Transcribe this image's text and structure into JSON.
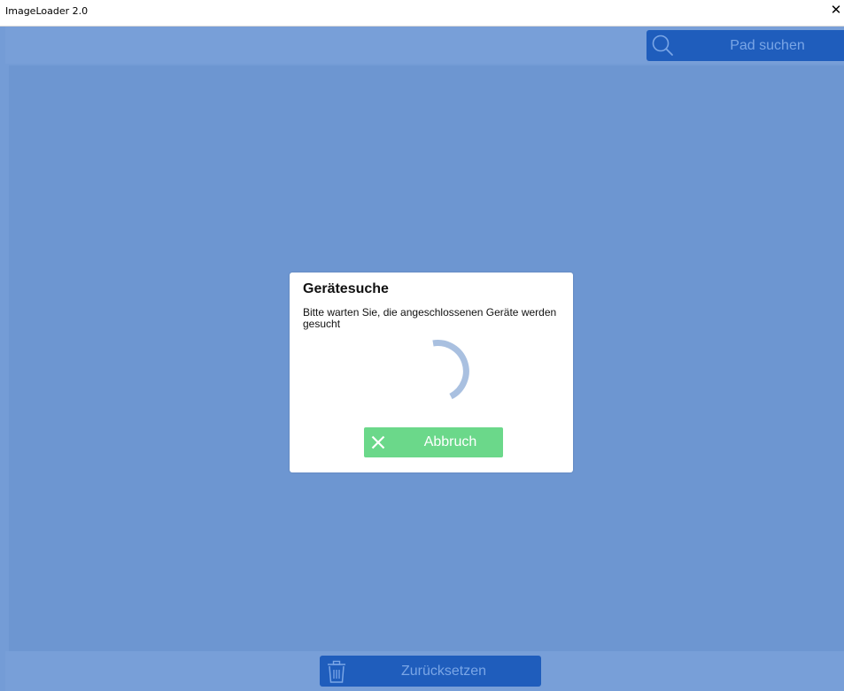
{
  "window": {
    "title": "ImageLoader 2.0",
    "close_glyph": "✕"
  },
  "toolbar": {
    "search_label": "Pad suchen",
    "search_icon": "search-icon"
  },
  "dialog": {
    "title": "Gerätesuche",
    "message": "Bitte warten Sie, die angeschlossenen Geräte werden gesucht",
    "cancel_label": "Abbruch",
    "cancel_icon": "close-icon"
  },
  "footer": {
    "reset_label": "Zurücksetzen",
    "reset_icon": "trash-icon"
  },
  "colors": {
    "background": "#6d96d1",
    "bar": "#789fd8",
    "button_blue": "#1f5dbc",
    "button_text": "#7aa6e6",
    "cancel_green": "#6bd88a",
    "spinner": "#a9c0e0"
  }
}
